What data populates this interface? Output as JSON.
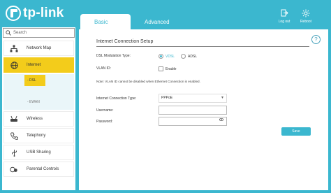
{
  "brand": {
    "name": "tp-link"
  },
  "tabs": [
    {
      "label": "Basic"
    },
    {
      "label": "Advanced"
    }
  ],
  "header": {
    "logout_label": "Log out",
    "reboot_label": "Reboot"
  },
  "sidebar": {
    "search_placeholder": "Search",
    "items": [
      {
        "label": "Network Map",
        "icon": "network-map-icon"
      },
      {
        "label": "Internet",
        "icon": "globe-icon"
      },
      {
        "label": "Wireless",
        "icon": "wifi-icon"
      },
      {
        "label": "Telephony",
        "icon": "phone-icon"
      },
      {
        "label": "USB Sharing",
        "icon": "usb-icon"
      },
      {
        "label": "Parental Controls",
        "icon": "parental-controls-icon"
      }
    ],
    "internet_sub": [
      {
        "label": "- DSL"
      },
      {
        "label": "- EWAN"
      }
    ]
  },
  "main": {
    "title": "Internet Connection Setup",
    "help": "?",
    "dsl_modulation_label": "DSL Modulation Type:",
    "vdsl_label": "VDSL",
    "adsl_label": "ADSL",
    "vlan_id_label": "VLAN ID:",
    "enable_label": "Enable",
    "note": "Note: VLAN ID cannot be disabled when Ethernet Connection is enabled.",
    "connection_type_label": "Internet Connection Type:",
    "connection_type_value": "PPPoE",
    "username_label": "Username:",
    "username_value": "",
    "password_label": "Password:",
    "password_value": "",
    "save_label": "Save"
  },
  "colors": {
    "accent": "#3bb7cf",
    "active": "#f3cc1b"
  }
}
